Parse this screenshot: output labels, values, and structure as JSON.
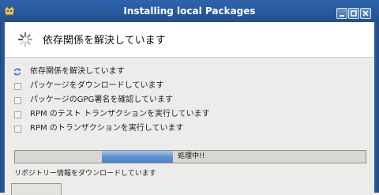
{
  "window": {
    "title": "Installing local Packages"
  },
  "header": {
    "text": "依存関係を解決しています"
  },
  "steps": [
    {
      "label": "依存関係を解決しています",
      "icon": "refresh-icon",
      "state": "active"
    },
    {
      "label": "パッケージをダウンロードしています",
      "icon": "checkbox-icon",
      "state": "pending"
    },
    {
      "label": "パッケージのGPG署名を確認しています",
      "icon": "checkbox-icon",
      "state": "pending"
    },
    {
      "label": "RPM のテスト トランザクションを実行しています",
      "icon": "checkbox-icon",
      "state": "pending"
    },
    {
      "label": "RPM のトランザクションを実行しています",
      "icon": "checkbox-icon",
      "state": "pending"
    }
  ],
  "progress": {
    "text": "処理中!!"
  },
  "status": {
    "text": "リポジトリー情報をダウンロードしています"
  },
  "colors": {
    "titlebar": "#2b5ca3",
    "progress_fill": "#5f93d4"
  }
}
